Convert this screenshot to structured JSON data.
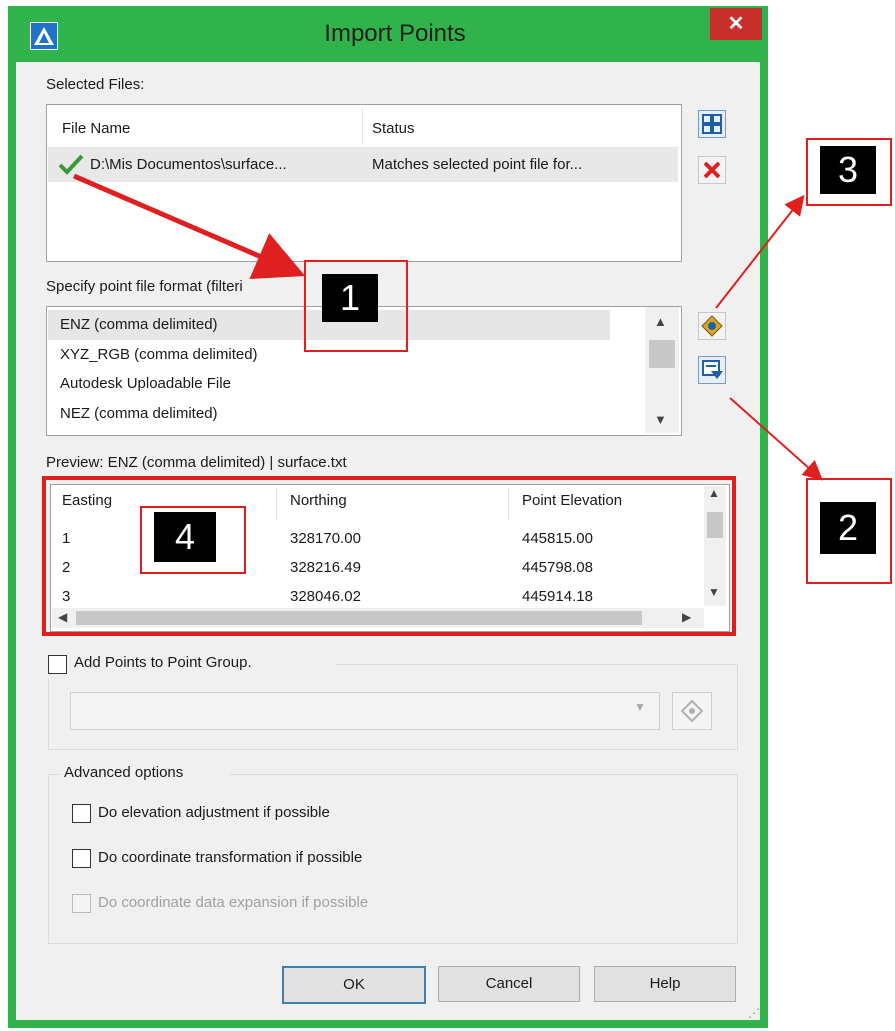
{
  "window": {
    "title": "Import Points",
    "close_label": "✕"
  },
  "selected_files": {
    "label": "Selected Files:",
    "columns": [
      "File Name",
      "Status"
    ],
    "rows": [
      {
        "file": "D:\\Mis Documentos\\surface...",
        "status": "Matches selected point file for..."
      }
    ]
  },
  "format": {
    "label": "Specify point file format (filteri",
    "items": [
      "ENZ (comma delimited)",
      "XYZ_RGB (comma delimited)",
      "Autodesk Uploadable File",
      "NEZ (comma delimited)"
    ]
  },
  "preview": {
    "label": "Preview: ENZ (comma delimited) | surface.txt",
    "columns": [
      "Easting",
      "Northing",
      "Point Elevation"
    ],
    "rows": [
      [
        "1",
        "328170.00",
        "445815.00"
      ],
      [
        "2",
        "328216.49",
        "445798.08"
      ],
      [
        "3",
        "328046.02",
        "445914.18"
      ]
    ]
  },
  "point_group": {
    "label": "Add Points to Point Group."
  },
  "advanced": {
    "label": "Advanced options",
    "options": [
      {
        "label": "Do elevation adjustment if possible",
        "enabled": true
      },
      {
        "label": "Do coordinate transformation if possible",
        "enabled": true
      },
      {
        "label": "Do coordinate data expansion if possible",
        "enabled": false
      }
    ]
  },
  "buttons": {
    "ok": "OK",
    "cancel": "Cancel",
    "help": "Help"
  },
  "annotations": [
    "1",
    "2",
    "3",
    "4"
  ],
  "colors": {
    "frame": "#2fb34a",
    "annotation": "#e02020",
    "close": "#c9302c"
  }
}
